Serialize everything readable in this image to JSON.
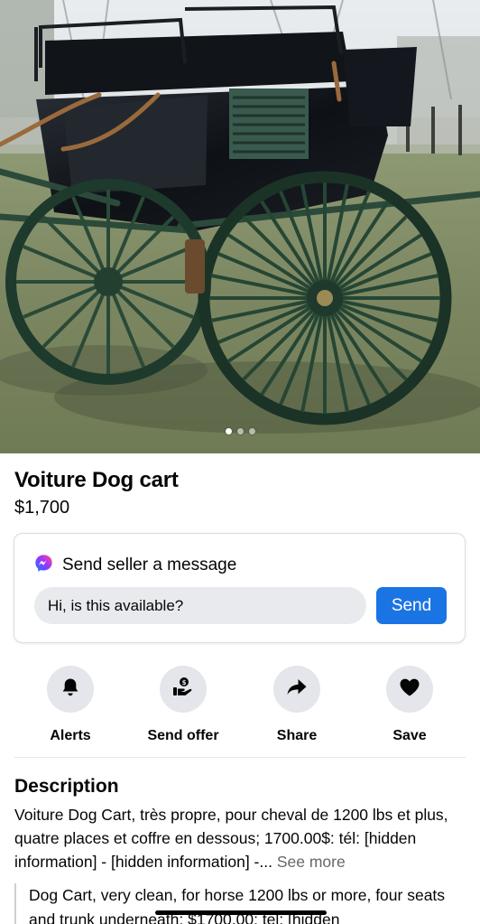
{
  "listing": {
    "title": "Voiture Dog cart",
    "price": "$1,700",
    "photo_count": 3,
    "active_photo": 1
  },
  "message": {
    "heading": "Send seller a message",
    "input_value": "Hi, is this available?",
    "send_label": "Send",
    "icon": "messenger-icon"
  },
  "actions": [
    {
      "label": "Alerts",
      "icon": "bell-icon"
    },
    {
      "label": "Send offer",
      "icon": "offer-hand-icon"
    },
    {
      "label": "Share",
      "icon": "share-arrow-icon"
    },
    {
      "label": "Save",
      "icon": "heart-icon"
    }
  ],
  "description": {
    "heading": "Description",
    "text": "Voiture Dog Cart, très propre, pour cheval de 1200 lbs et plus, quatre places et coffre en dessous; 1700.00$: tél: [hidden information] - [hidden information] -...",
    "see_more": "See more",
    "translation": "Dog Cart, very clean, for horse 1200 lbs or more, four seats and trunk underneath; $1700.00: tel: [hidden"
  },
  "colors": {
    "accent": "#1b74e4",
    "button_bg": "#e4e6eb",
    "input_bg": "#e8eaed"
  }
}
